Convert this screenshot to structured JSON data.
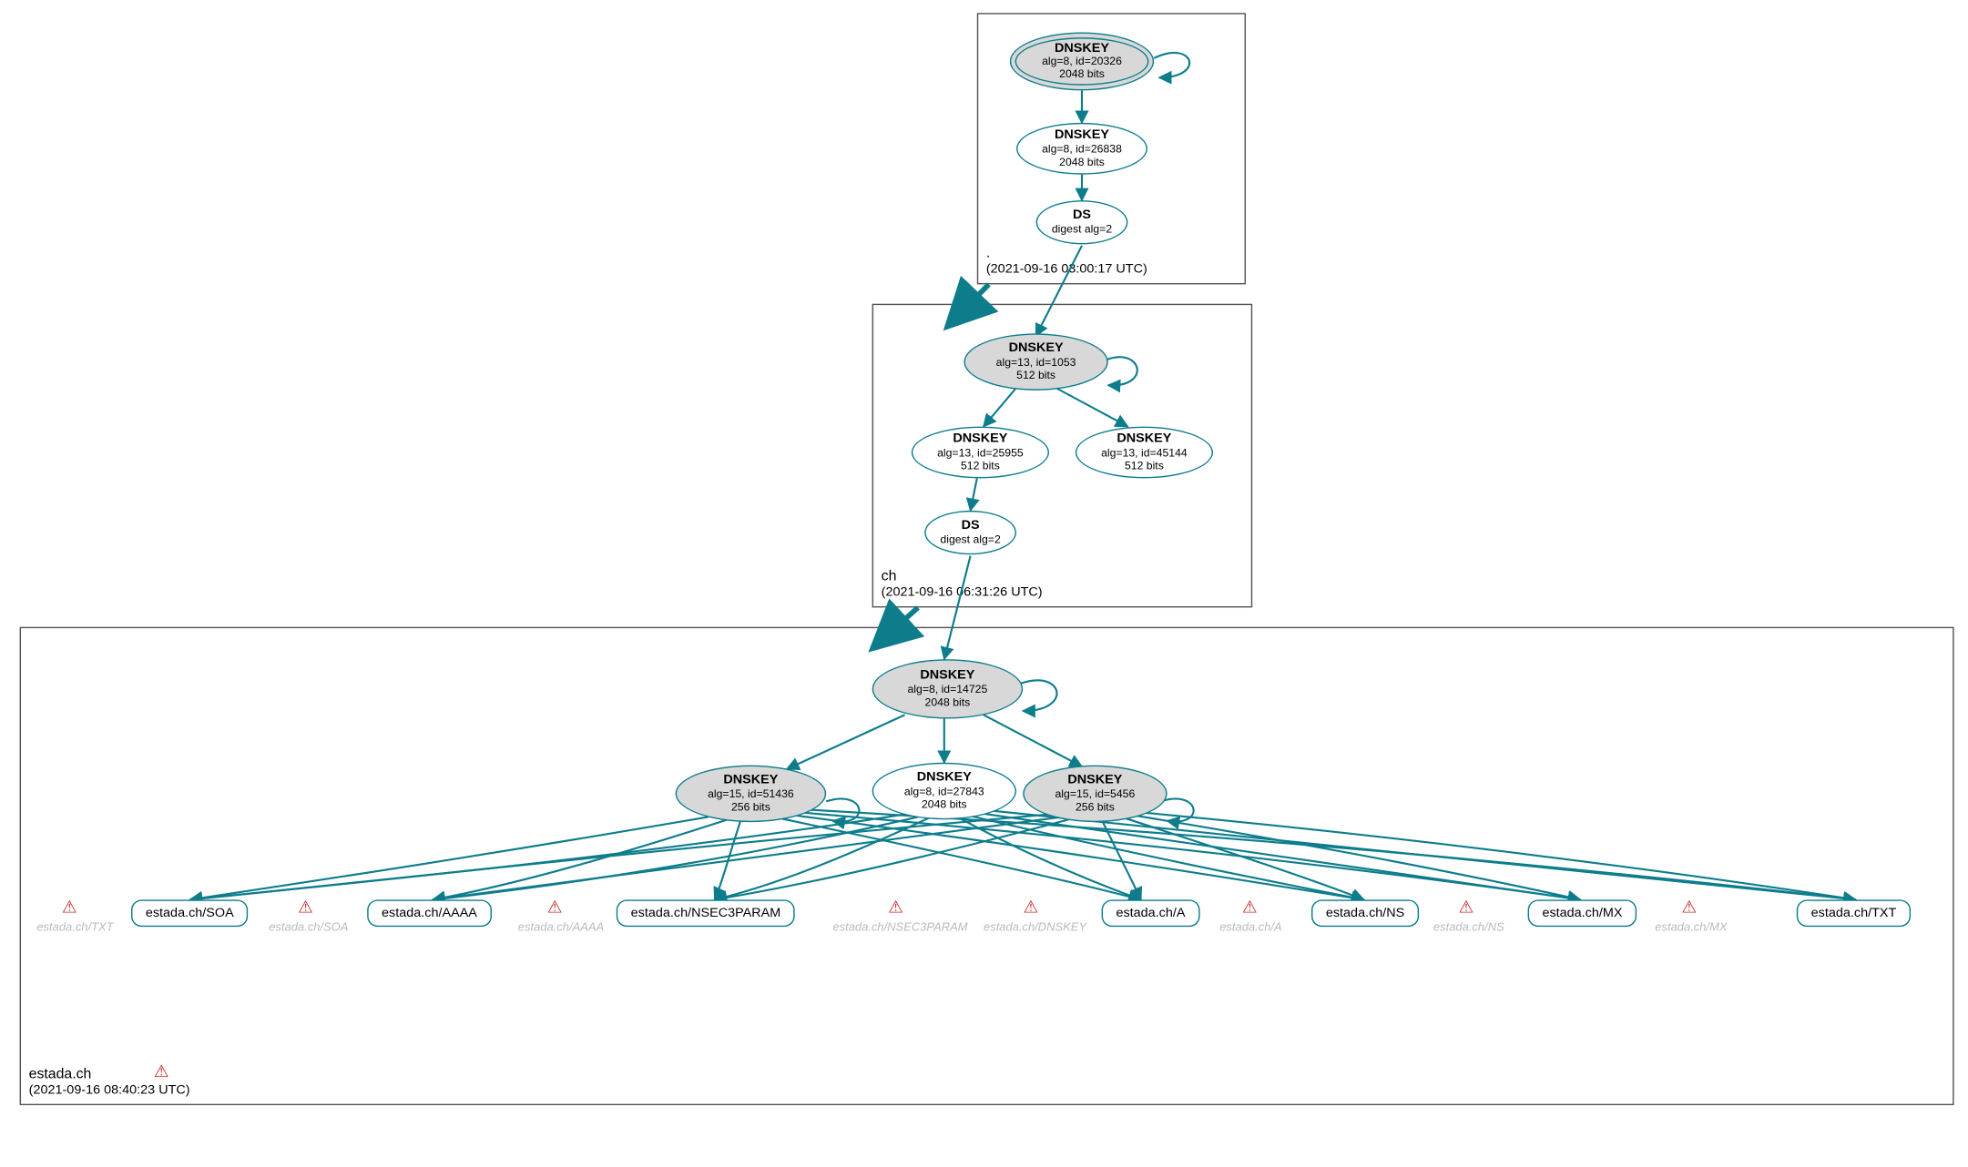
{
  "colors": {
    "edge": "#0d7d8c",
    "node_border": "#0d7d8c",
    "grey_fill": "#d8d8d8",
    "warn": "#c62828"
  },
  "zones": {
    "root": {
      "name": ".",
      "timestamp": "(2021-09-16 03:00:17 UTC)"
    },
    "ch": {
      "name": "ch",
      "timestamp": "(2021-09-16 06:31:26 UTC)"
    },
    "domain": {
      "name": "estada.ch",
      "timestamp": "(2021-09-16 08:40:23 UTC)"
    }
  },
  "nodes": {
    "root_ksk": {
      "title": "DNSKEY",
      "line2": "alg=8, id=20326",
      "line3": "2048 bits"
    },
    "root_zsk": {
      "title": "DNSKEY",
      "line2": "alg=8, id=26838",
      "line3": "2048 bits"
    },
    "root_ds": {
      "title": "DS",
      "line2": "digest alg=2",
      "line3": ""
    },
    "ch_ksk": {
      "title": "DNSKEY",
      "line2": "alg=13, id=1053",
      "line3": "512 bits"
    },
    "ch_zsk1": {
      "title": "DNSKEY",
      "line2": "alg=13, id=25955",
      "line3": "512 bits"
    },
    "ch_zsk2": {
      "title": "DNSKEY",
      "line2": "alg=13, id=45144",
      "line3": "512 bits"
    },
    "ch_ds": {
      "title": "DS",
      "line2": "digest alg=2",
      "line3": ""
    },
    "dom_ksk": {
      "title": "DNSKEY",
      "line2": "alg=8, id=14725",
      "line3": "2048 bits"
    },
    "dom_k_51436": {
      "title": "DNSKEY",
      "line2": "alg=15, id=51436",
      "line3": "256 bits"
    },
    "dom_k_27843": {
      "title": "DNSKEY",
      "line2": "alg=8, id=27843",
      "line3": "2048 bits"
    },
    "dom_k_5456": {
      "title": "DNSKEY",
      "line2": "alg=15, id=5456",
      "line3": "256 bits"
    }
  },
  "rrsets": {
    "soa": "estada.ch/SOA",
    "aaaa": "estada.ch/AAAA",
    "nsec3param": "estada.ch/NSEC3PARAM",
    "a": "estada.ch/A",
    "ns": "estada.ch/NS",
    "mx": "estada.ch/MX",
    "txt": "estada.ch/TXT"
  },
  "ghosts": {
    "g_txt_left": "estada.ch/TXT",
    "g_soa": "estada.ch/SOA",
    "g_aaaa": "estada.ch/AAAA",
    "g_nsec3": "estada.ch/NSEC3PARAM",
    "g_dnskey": "estada.ch/DNSKEY",
    "g_a": "estada.ch/A",
    "g_ns": "estada.ch/NS",
    "g_mx": "estada.ch/MX"
  }
}
